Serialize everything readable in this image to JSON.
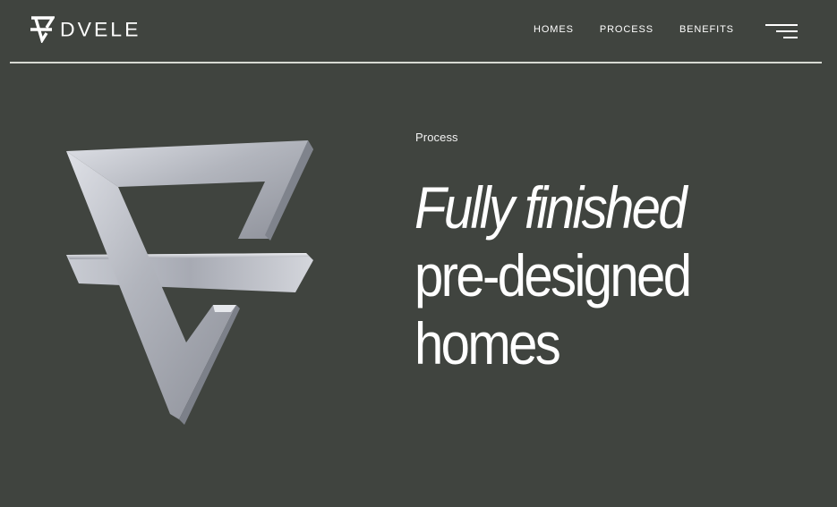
{
  "brand": {
    "logo_icon": "dvele-triangle-mark-icon",
    "name": "DVELE"
  },
  "nav": {
    "items": [
      {
        "label": "HOMES"
      },
      {
        "label": "PROCESS"
      },
      {
        "label": "BENEFITS"
      }
    ],
    "menu_icon": "hamburger-menu-icon"
  },
  "hero": {
    "image_icon": "dvele-3d-logo-mark",
    "eyebrow": "Process",
    "headline": {
      "line1": "Fully finished",
      "line2": "pre-designed",
      "line3": "homes"
    }
  },
  "colors": {
    "background": "#40443f",
    "text": "#ffffff",
    "divider": "#d7d9d3",
    "mark_metal": "#b9bcc4"
  }
}
